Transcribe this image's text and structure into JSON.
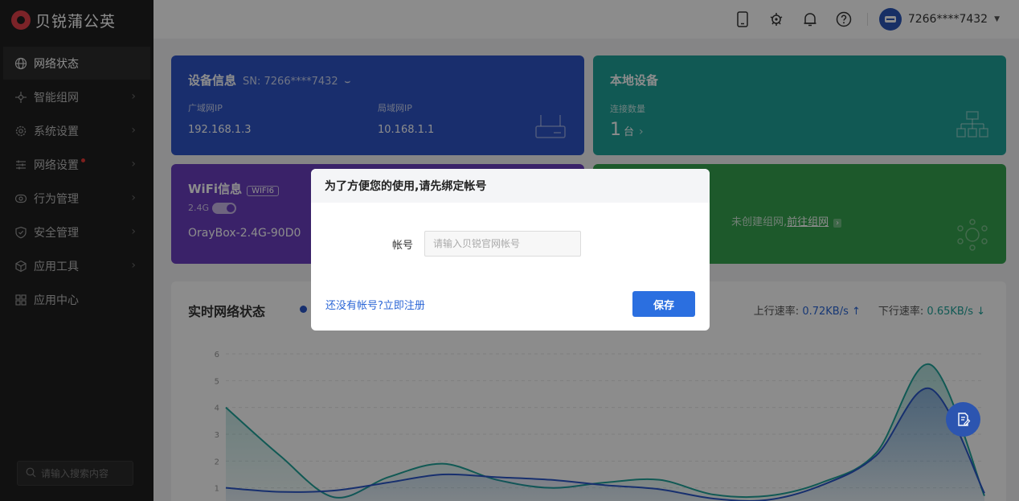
{
  "app": {
    "logo_text": "贝锐蒲公英"
  },
  "sidebar": {
    "items": [
      {
        "label": "网络状态",
        "icon": "globe-icon"
      },
      {
        "label": "智能组网",
        "icon": "network-icon"
      },
      {
        "label": "系统设置",
        "icon": "gear-icon"
      },
      {
        "label": "网络设置",
        "icon": "sliders-icon"
      },
      {
        "label": "行为管理",
        "icon": "eye-icon"
      },
      {
        "label": "安全管理",
        "icon": "shield-icon"
      },
      {
        "label": "应用工具",
        "icon": "box-icon"
      },
      {
        "label": "应用中心",
        "icon": "grid-icon"
      }
    ],
    "search_placeholder": "请输入搜索内容"
  },
  "topbar": {
    "username": "7266****7432"
  },
  "device_card": {
    "title": "设备信息",
    "sn": "SN: 7266****7432",
    "wan_label": "广域网IP",
    "wan_ip": "192.168.1.3",
    "lan_label": "局域网IP",
    "lan_ip": "10.168.1.1"
  },
  "local_card": {
    "title": "本地设备",
    "count_label": "连接数量",
    "count": "1",
    "unit": "台"
  },
  "wifi_card": {
    "title": "WiFi信息",
    "tag": "WIFI6",
    "band": "2.4G",
    "ssid": "OrayBox-2.4G-90D0"
  },
  "group_card": {
    "text": "未创建组网,",
    "link": "前往组网"
  },
  "chart_section": {
    "title": "实时网络状态",
    "up_label": "上行速率:",
    "up_value": "0.72KB/s ↑",
    "down_label": "下行速率:",
    "down_value": "0.65KB/s ↓"
  },
  "chart_data": {
    "type": "area",
    "ylim": [
      0,
      6
    ],
    "yticks": [
      "1",
      "2",
      "3",
      "4",
      "5",
      "6"
    ],
    "x": [
      0,
      1,
      2,
      3,
      4,
      5,
      6,
      7,
      8,
      9,
      10,
      11,
      12,
      13,
      14
    ],
    "series": [
      {
        "values": [
          4.0,
          2.2,
          0.65,
          1.4,
          1.9,
          1.3,
          1.0,
          1.2,
          1.3,
          0.75,
          0.7,
          1.2,
          2.3,
          5.6,
          0.7
        ],
        "color": "#1fa39a"
      },
      {
        "values": [
          1.0,
          0.85,
          0.9,
          1.2,
          1.5,
          1.4,
          1.3,
          1.1,
          0.95,
          0.6,
          0.55,
          1.1,
          2.2,
          4.7,
          0.8
        ],
        "color": "#2b57c8"
      }
    ]
  },
  "modal": {
    "title": "为了方便您的使用,请先绑定帐号",
    "field_label": "帐号",
    "field_placeholder": "请输入贝锐官网帐号",
    "field_value": "",
    "register_link": "还没有帐号?立即注册",
    "save_label": "保存"
  }
}
